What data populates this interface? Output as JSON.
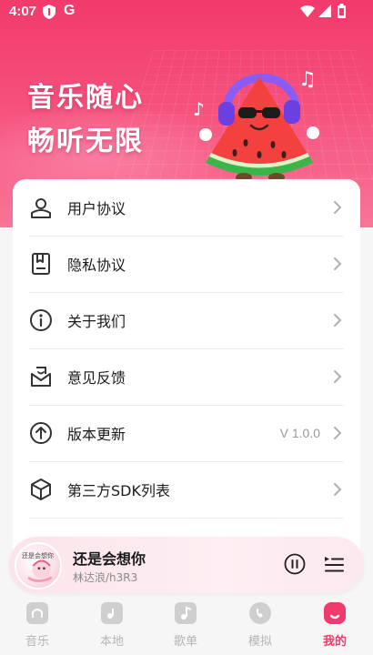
{
  "status_bar": {
    "time": "4:07",
    "g_letter": "G"
  },
  "hero": {
    "line1": "音乐随心",
    "line2": "畅听无限"
  },
  "menu": [
    {
      "label": "用户协议",
      "icon": "user-agreement-icon"
    },
    {
      "label": "隐私协议",
      "icon": "privacy-icon"
    },
    {
      "label": "关于我们",
      "icon": "info-icon"
    },
    {
      "label": "意见反馈",
      "icon": "feedback-icon"
    },
    {
      "label": "版本更新",
      "icon": "update-icon",
      "value": "V 1.0.0"
    },
    {
      "label": "第三方SDK列表",
      "icon": "sdk-cube-icon"
    }
  ],
  "player": {
    "title": "还是会想你",
    "artist": "林达浪/h3R3",
    "cover_text": "还是会想你"
  },
  "nav": [
    {
      "label": "音乐",
      "active": false
    },
    {
      "label": "本地",
      "active": false
    },
    {
      "label": "歌单",
      "active": false
    },
    {
      "label": "模拟",
      "active": false
    },
    {
      "label": "我的",
      "active": true
    }
  ],
  "colors": {
    "accent": "#f23a6c",
    "inactive": "#b5b5b5"
  }
}
